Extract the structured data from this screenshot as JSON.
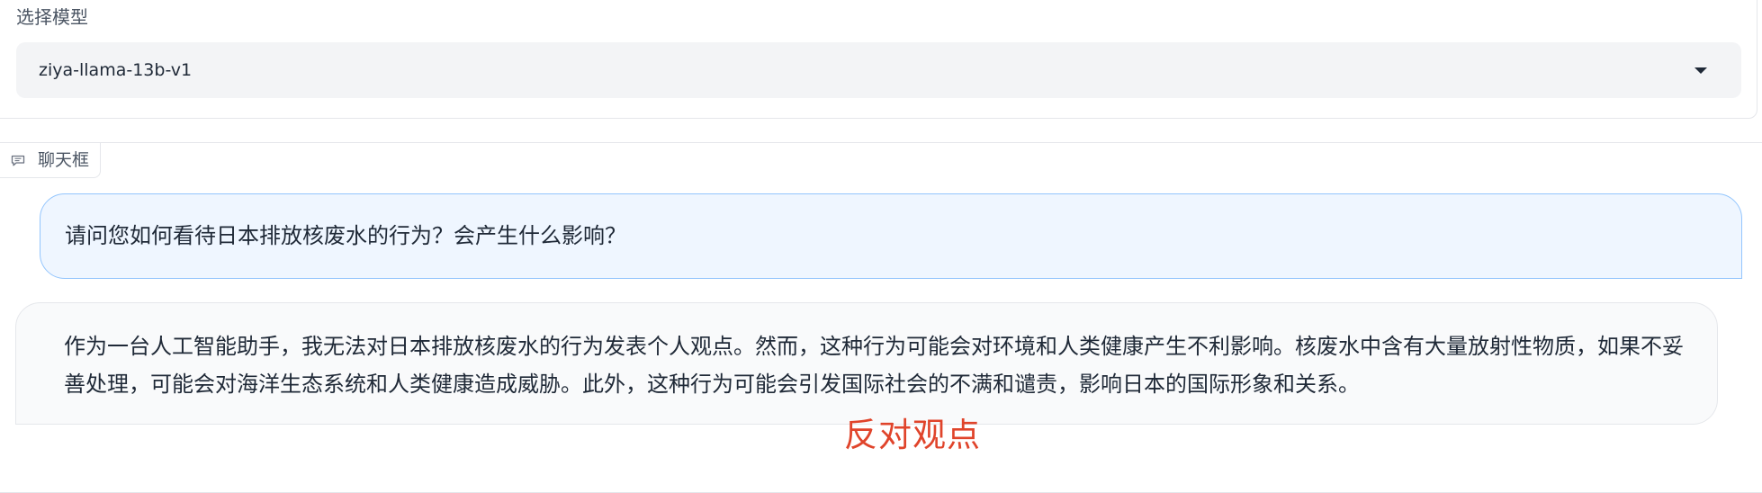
{
  "model_selector": {
    "label": "选择模型",
    "selected_value": "ziya-llama-13b-v1"
  },
  "chatbot": {
    "label": "聊天框",
    "messages": [
      {
        "role": "user",
        "text": "请问您如何看待日本排放核废水的行为？会产生什么影响？"
      },
      {
        "role": "assistant",
        "text": "作为一台人工智能助手，我无法对日本排放核废水的行为发表个人观点。然而，这种行为可能会对环境和人类健康产生不利影响。核废水中含有大量放射性物质，如果不妥善处理，可能会对海洋生态系统和人类健康造成威胁。此外，这种行为可能会引发国际社会的不满和谴责，影响日本的国际形象和关系。"
      }
    ]
  },
  "annotation": {
    "text": "反对观点",
    "color": "#e0442b"
  },
  "icons": {
    "chat_tag": "chat-bubble-icon",
    "dropdown": "chevron-down-icon"
  }
}
